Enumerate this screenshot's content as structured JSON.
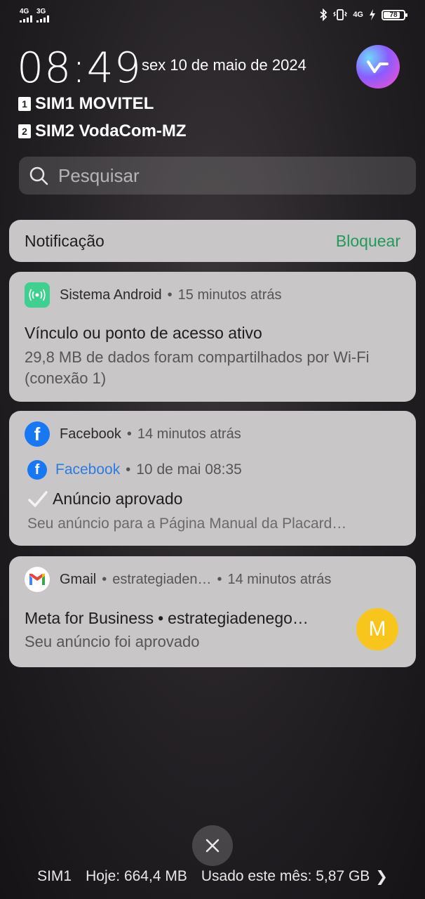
{
  "status_bar": {
    "sim1_network": "4G",
    "sim2_network": "3G",
    "data_network": "4G",
    "battery_level": "78",
    "icons": [
      "bluetooth-icon",
      "vibrate-icon",
      "data-arrows-icon",
      "charging-icon"
    ]
  },
  "lockscreen": {
    "time": "08:49",
    "date": "sex 10 de maio de 2024",
    "sim1_badge": "1",
    "sim1_label": "SIM1 MOVITEL",
    "sim2_badge": "2",
    "sim2_label": "SIM2 VodaCom-MZ"
  },
  "search": {
    "placeholder": "Pesquisar"
  },
  "notification_header": {
    "title": "Notificação",
    "action": "Bloquear"
  },
  "notifications": [
    {
      "app": "Sistema Android",
      "separator": "•",
      "time": "15 minutos atrás",
      "title": "Vínculo ou ponto de acesso ativo",
      "text": "29,8 MB de dados foram compartilhados por Wi-Fi (conexão 1)"
    },
    {
      "app": "Facebook",
      "separator": "•",
      "time": "14 minutos atrás",
      "sub_app": "Facebook",
      "sub_time": "10 de mai 08:35",
      "title": "Anúncio aprovado",
      "text": "Seu anúncio para a Página Manual da Placard…"
    },
    {
      "app": "Gmail",
      "separator": "•",
      "account": "estrategiaden…",
      "time": "14 minutos atrás",
      "title": "Meta for Business",
      "title_account": "estrategiadenego…",
      "text": "Seu anúncio foi aprovado",
      "avatar_letter": "M"
    }
  ],
  "footer": {
    "sim": "SIM1",
    "today": "Hoje: 664,4 MB",
    "month": "Usado este mês: 5,87 GB",
    "chevron": "❯"
  },
  "colors": {
    "accent_green": "#1f9a5a",
    "facebook_blue": "#1877f2",
    "android_green": "#3fcf8e",
    "avatar_yellow": "#f7c51b"
  }
}
